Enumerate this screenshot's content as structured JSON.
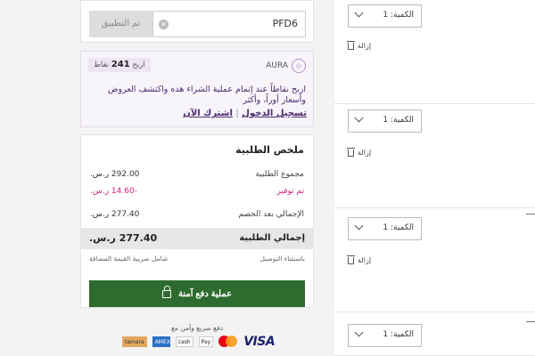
{
  "promo": {
    "code_value": "PFD6",
    "clear_icon": "close-icon",
    "apply_label": "تم التطبيق"
  },
  "aura": {
    "brand": "AURA",
    "points_prefix": "اربح",
    "points_value": "241",
    "points_suffix": "نقاط",
    "message": "اربح نقاطاً عند إتمام عملية الشراء هذه واكتشف العروض وأسعار أوراً، وأكثر",
    "login_label": "تسجيل الدخول",
    "separator": "|",
    "subscribe_label": "اشترك الآن"
  },
  "summary": {
    "title": "ملخص الطلبية",
    "rows": [
      {
        "label": "مجموع الطلبية",
        "value": "292.00 ر.س."
      },
      {
        "label": "تم توفير",
        "value": "-14.60 ر.س."
      },
      {
        "label": "الإجمالي بعد الخصم",
        "value": "277.40 ر.س."
      }
    ],
    "total_label": "إجمالي الطلبية",
    "total_value": "277.40 ر.س.",
    "note_right": "باستثناء التوصيل",
    "note_left": "شامل ضريبة القيمة المضافة",
    "checkout_label": "عملية دفع آمنة"
  },
  "payment": {
    "note": "دفع سريع وآمن مع",
    "methods": [
      "tamara",
      "AMEX",
      "cash",
      "Pay",
      "mastercard",
      "VISA"
    ]
  },
  "products": [
    {
      "qty_label": "الكمية: 1",
      "remove_label": "إزالة"
    },
    {
      "qty_label": "الكمية: 1",
      "remove_label": "إزالة"
    },
    {
      "qty_label": "الكمية: 1",
      "remove_label": "إزالة"
    },
    {
      "qty_label": "الكمية: 1"
    }
  ],
  "colors": {
    "checkout": "#2e6b2e",
    "discount": "#d1237a",
    "aura_text": "#4a2a6d"
  }
}
